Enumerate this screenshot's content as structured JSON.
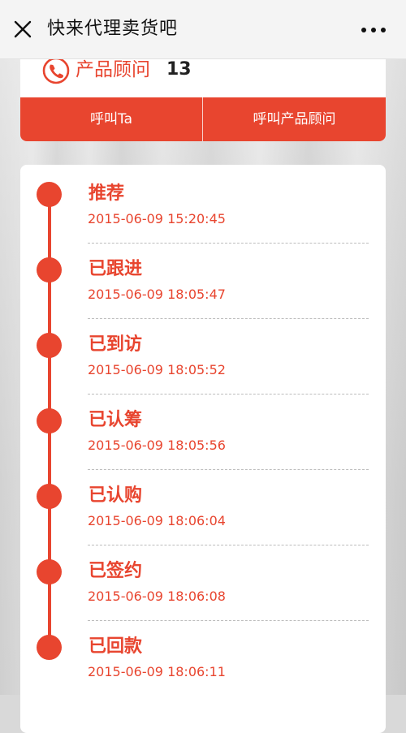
{
  "nav": {
    "title": "快来代理卖货吧",
    "close_icon": "close-icon",
    "more_icon": "more-icon"
  },
  "consultant": {
    "label": "产品顾问",
    "phone": "13",
    "icon": "phone-icon"
  },
  "buttons": {
    "call_ta": "呼叫Ta",
    "call_consultant": "呼叫产品顾问"
  },
  "timeline": [
    {
      "title": "推荐",
      "time": "2015-06-09 15:20:45"
    },
    {
      "title": "已跟进",
      "time": "2015-06-09 18:05:47"
    },
    {
      "title": "已到访",
      "time": "2015-06-09 18:05:52"
    },
    {
      "title": "已认筹",
      "time": "2015-06-09 18:05:56"
    },
    {
      "title": "已认购",
      "time": "2015-06-09 18:06:04"
    },
    {
      "title": "已签约",
      "time": "2015-06-09 18:06:08"
    },
    {
      "title": "已回款",
      "time": "2015-06-09 18:06:11"
    }
  ],
  "colors": {
    "accent": "#e8452f",
    "navbar": "#f4f4f4",
    "card": "#ffffff"
  }
}
